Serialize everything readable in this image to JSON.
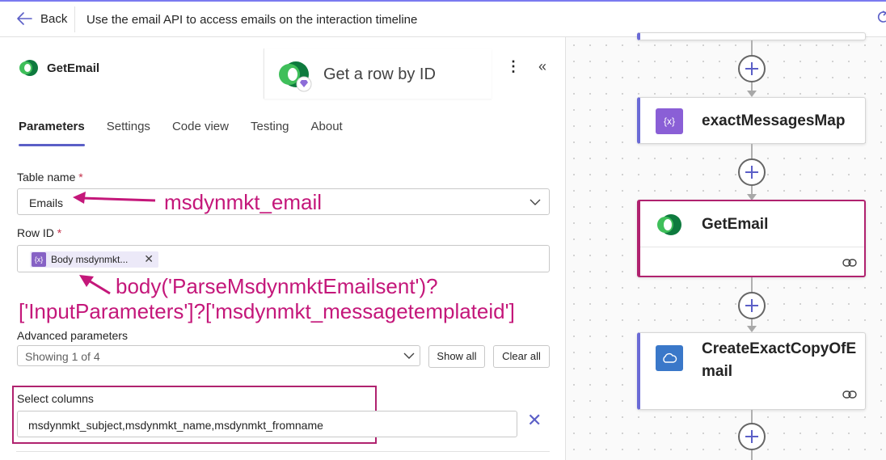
{
  "header": {
    "back_label": "Back",
    "title": "Use the email API to access emails on the interaction timeline"
  },
  "action": {
    "name": "GetEmail",
    "connector_name": "Get a row by ID",
    "more_label": "⋮",
    "collapse_label": "«"
  },
  "tabs": [
    {
      "label": "Parameters",
      "active": true
    },
    {
      "label": "Settings"
    },
    {
      "label": "Code view"
    },
    {
      "label": "Testing"
    },
    {
      "label": "About"
    }
  ],
  "fields": {
    "table_name": {
      "label": "Table name",
      "required_mark": "*",
      "value": "Emails"
    },
    "row_id": {
      "label": "Row ID",
      "required_mark": "*",
      "token_icon": "{x}",
      "token_text": "Body msdynmkt...",
      "token_remove": "✕"
    },
    "advanced": {
      "label": "Advanced parameters",
      "value": "Showing 1 of 4",
      "show_all": "Show all",
      "clear_all": "Clear all"
    },
    "select_columns": {
      "label": "Select columns",
      "value": "msdynmkt_subject,msdynmkt_name,msdynmkt_fromname",
      "clear_icon": "✕"
    }
  },
  "annotations": {
    "table": "msdynmkt_email",
    "row_line1": "body('ParseMsdynmktEmailsent')?",
    "row_line2": "['InputParameters']?['msdynmkt_messagetemplateid']"
  },
  "canvas": {
    "nodes": [
      {
        "title": "exactMessagesMap",
        "icon": "{x}"
      },
      {
        "title": "GetEmail"
      },
      {
        "title_line1": "CreateExactCopyOfE",
        "title_line2": "mail"
      }
    ]
  },
  "colors": {
    "accent": "#5b5fc7",
    "annotation": "#c4177a",
    "highlight_border": "#b0226f",
    "variable_purple": "#8661c5",
    "cloud_blue": "#3a78c9"
  },
  "icons": [
    "back-arrow-icon",
    "refresh-icon",
    "dataverse-logo-icon",
    "premium-diamond-icon",
    "chevron-down-icon",
    "variable-icon",
    "link-icon",
    "cloud-icon",
    "add-icon"
  ]
}
